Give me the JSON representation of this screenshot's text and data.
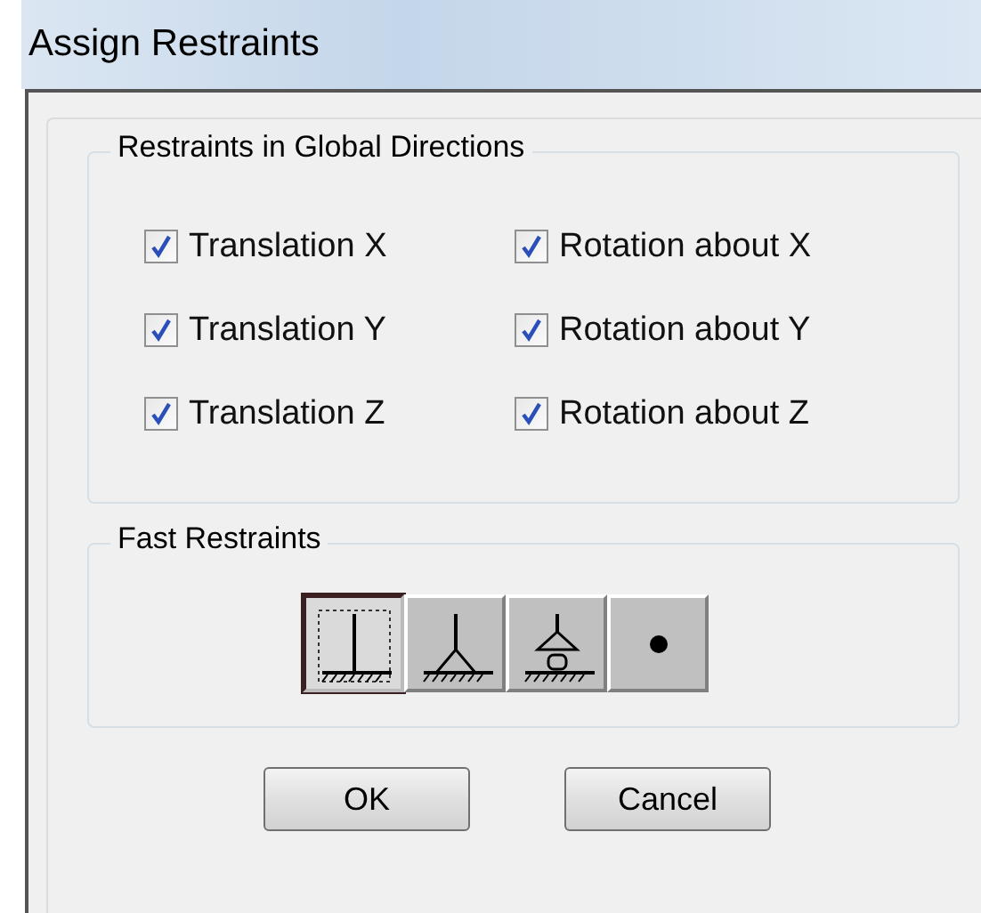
{
  "window": {
    "title": "Assign Restraints"
  },
  "restraints_group": {
    "title": "Restraints in Global Directions",
    "options": [
      {
        "label": "Translation X",
        "checked": true
      },
      {
        "label": "Rotation about X",
        "checked": true
      },
      {
        "label": "Translation Y",
        "checked": true
      },
      {
        "label": "Rotation about Y",
        "checked": true
      },
      {
        "label": "Translation Z",
        "checked": true
      },
      {
        "label": "Rotation about Z",
        "checked": true
      }
    ]
  },
  "fast_group": {
    "title": "Fast Restraints",
    "buttons": [
      {
        "kind": "fixed",
        "selected": true
      },
      {
        "kind": "pinned",
        "selected": false
      },
      {
        "kind": "roller",
        "selected": false
      },
      {
        "kind": "free",
        "selected": false
      }
    ]
  },
  "buttons": [
    "OK",
    "Cancel"
  ]
}
